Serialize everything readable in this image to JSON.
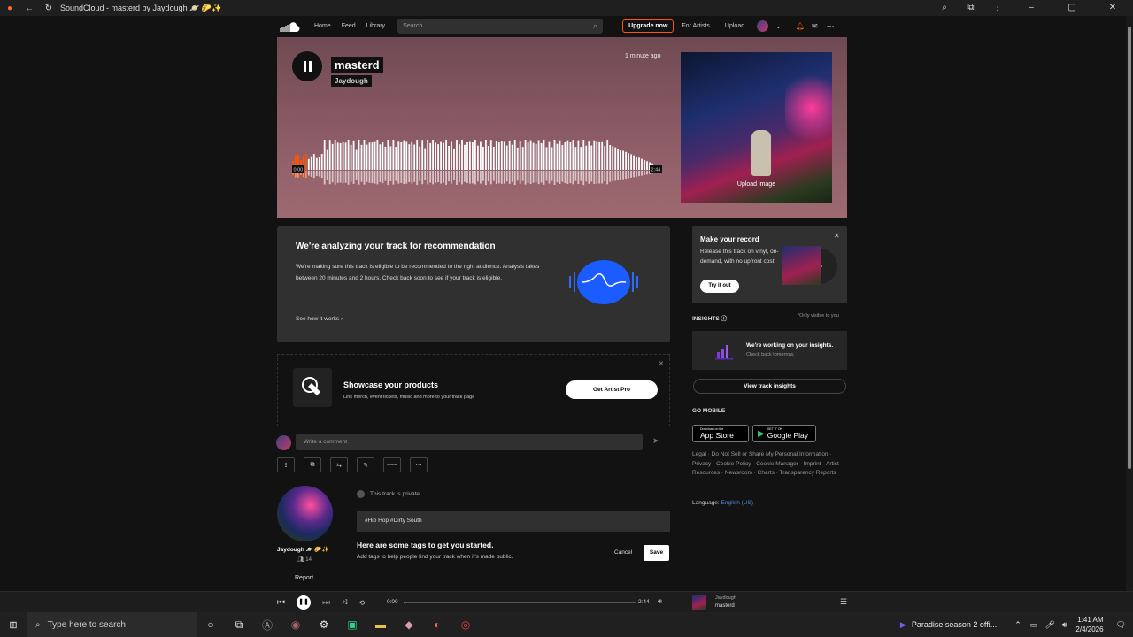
{
  "browser": {
    "tab_title": "SoundCloud - masterd by Jaydough 🪐 🌮✨"
  },
  "nav": {
    "home": "Home",
    "feed": "Feed",
    "library": "Library",
    "search_placeholder": "Search",
    "upgrade": "Upgrade now",
    "for_artists": "For Artists",
    "upload": "Upload"
  },
  "hero": {
    "title": "masterd",
    "artist": "Jaydough",
    "posted": "1 minute ago",
    "elapsed": "0:00",
    "duration": "2:44",
    "upload_image": "Upload image"
  },
  "analyze": {
    "heading": "We're analyzing your track for recommendation",
    "body": "We're making sure this track is eligible to be recommended to the right audience. Analysis takes between 20 minutes and 2 hours. Check back soon to see if your track is eligible.",
    "link": "See how it works"
  },
  "showcase": {
    "heading": "Showcase your products",
    "sub": "Link merch, event tickets, music and more to your track page",
    "button": "Get Artist Pro"
  },
  "comment": {
    "placeholder": "Write a comment"
  },
  "track": {
    "privacy": "This track is private.",
    "tags": "#Hip Hop  #Dirty South",
    "tags_heading": "Here are some tags to get you started.",
    "tags_sub": "Add tags to help people find your track when it's made public.",
    "cancel": "Cancel",
    "save": "Save"
  },
  "user": {
    "name": "Jaydough 🪐 🌮✨",
    "followers": "14",
    "report": "Report"
  },
  "sidebar": {
    "vinyl_heading": "Make your record",
    "vinyl_body": "Release this track on vinyl, on-demand, with no upfront cost.",
    "vinyl_button": "Try it out",
    "insights_heading": "INSIGHTS",
    "insights_only": "*Only visible to you",
    "insights_main": "We're working on your insights.",
    "insights_sub": "Check back tomorrow.",
    "view_insights": "View track insights",
    "go_mobile": "GO MOBILE",
    "app_store_top": "Download on the",
    "app_store": "App Store",
    "google_top": "GET IT ON",
    "google": "Google Play",
    "links": "Legal · Do Not Sell or Share My Personal Information · Privacy · Cookie Policy · Cookie Manager · Imprint · Artist Resources · Newsroom · Charts · Transparency Reports",
    "language_label": "Language:",
    "language_value": "English (US)"
  },
  "player": {
    "elapsed": "0:00",
    "duration": "2:44",
    "progress": 0.005,
    "artist": "Jaydough",
    "title": "masterd"
  },
  "taskbar": {
    "search": "Type here to search",
    "notification": "Paradise season 2 offi...",
    "time": "1:41 AM",
    "date": "2/4/2026"
  }
}
